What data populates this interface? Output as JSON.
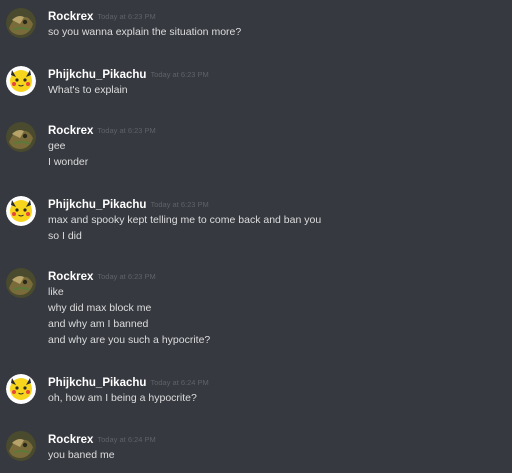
{
  "messages": [
    {
      "author": "Rockrex",
      "avatar_icon": "rockrex-avatar-icon",
      "timestamp": "Today at 6:23 PM",
      "lines": [
        "so you wanna explain the situation more?"
      ]
    },
    {
      "author": "Phijkchu_Pikachu",
      "avatar_icon": "pikachu-avatar-icon",
      "timestamp": "Today at 6:23 PM",
      "lines": [
        "What's to explain"
      ]
    },
    {
      "author": "Rockrex",
      "avatar_icon": "rockrex-avatar-icon",
      "timestamp": "Today at 6:23 PM",
      "lines": [
        "gee",
        "I wonder"
      ]
    },
    {
      "author": "Phijkchu_Pikachu",
      "avatar_icon": "pikachu-avatar-icon",
      "timestamp": "Today at 6:23 PM",
      "lines": [
        "max and spooky kept telling me to come back and ban you",
        "so I did"
      ]
    },
    {
      "author": "Rockrex",
      "avatar_icon": "rockrex-avatar-icon",
      "timestamp": "Today at 6:23 PM",
      "lines": [
        "like",
        "why did max block me",
        "and why am I banned",
        "and why are you such a hypocrite?"
      ]
    },
    {
      "author": "Phijkchu_Pikachu",
      "avatar_icon": "pikachu-avatar-icon",
      "timestamp": "Today at 6:24 PM",
      "lines": [
        "oh, how am I being a hypocrite?"
      ]
    },
    {
      "author": "Rockrex",
      "avatar_icon": "rockrex-avatar-icon",
      "timestamp": "Today at 6:24 PM",
      "lines": [
        "you baned me"
      ]
    }
  ],
  "colors": {
    "background": "#36393f",
    "username": "#ffffff",
    "timestamp": "#5f6269",
    "message_text": "#dcddde"
  }
}
